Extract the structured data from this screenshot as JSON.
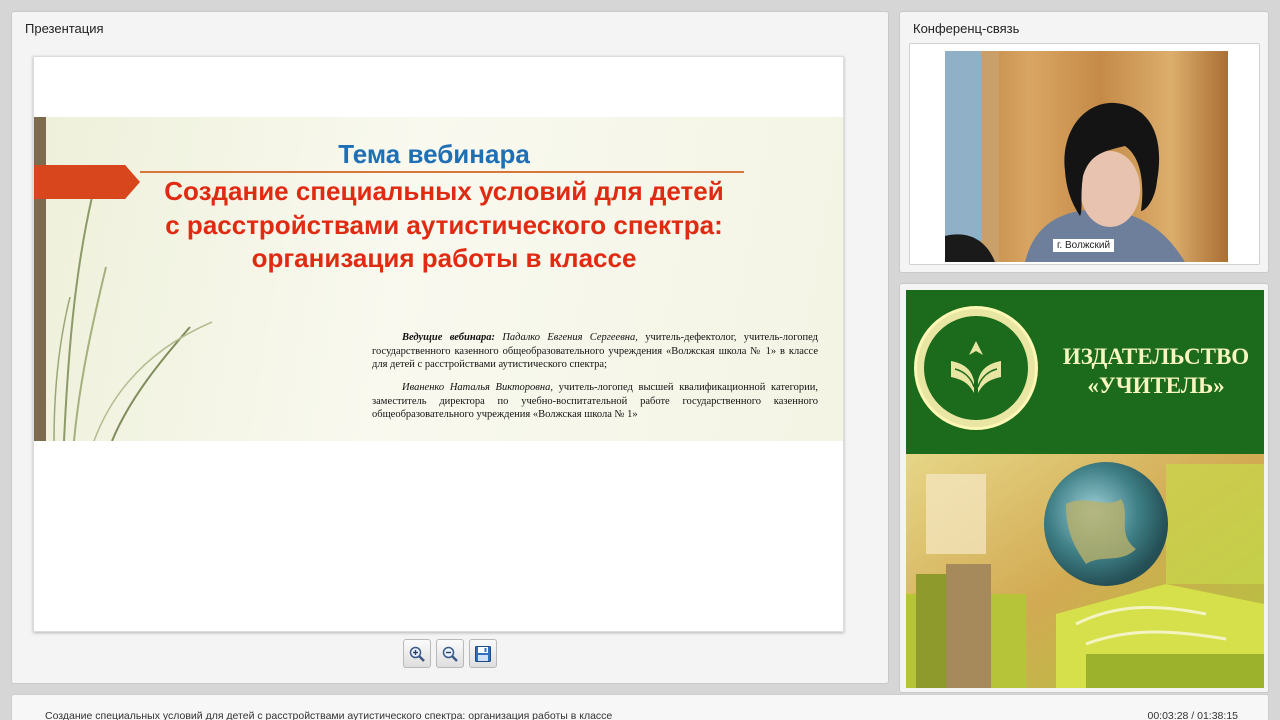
{
  "panels": {
    "presentation_title": "Презентация",
    "conference_title": "Конференц-связь"
  },
  "slide": {
    "theme": "Тема вебинара",
    "title": "Создание специальных условий для детей с расстройствами аутистического спектра: организация работы в классе",
    "presenter1_lead": "Ведущие вебинара:",
    "presenter1_name": "Падалко Евгения Сергеевна,",
    "presenter1_desc": "учитель-дефектолог, учитель-логопед государственного казенного общеобразовательного учреждения «Волжская школа № 1» в классе для детей с расстройствами аутистического спектра;",
    "presenter2_name": "Иваненко Наталья Викторовна,",
    "presenter2_desc": "учитель-логопед высшей квалификационной категории, заместитель директора по учебно-воспитательной работе государственного казенного общеобразовательного учреждения «Волжская школа № 1»"
  },
  "toolbar": {
    "zoom_in_icon": "zoom-in-icon",
    "zoom_out_icon": "zoom-out-icon",
    "save_icon": "floppy-disk-icon"
  },
  "video": {
    "location_label": "г. Волжский"
  },
  "ad": {
    "publisher_line1": "ИЗДАТЕЛЬСТВО",
    "publisher_line2": "«УЧИТЕЛЬ»"
  },
  "footer": {
    "title": "Создание специальных условий для детей с расстройствами аутистического спектра: организация работы в классе",
    "time": "00:03:28 / 01:38:15"
  },
  "colors": {
    "slide_theme": "#1f6fb5",
    "slide_title": "#e02a12",
    "ad_green": "#1c6b1c",
    "ad_text": "#f8f6c0"
  }
}
